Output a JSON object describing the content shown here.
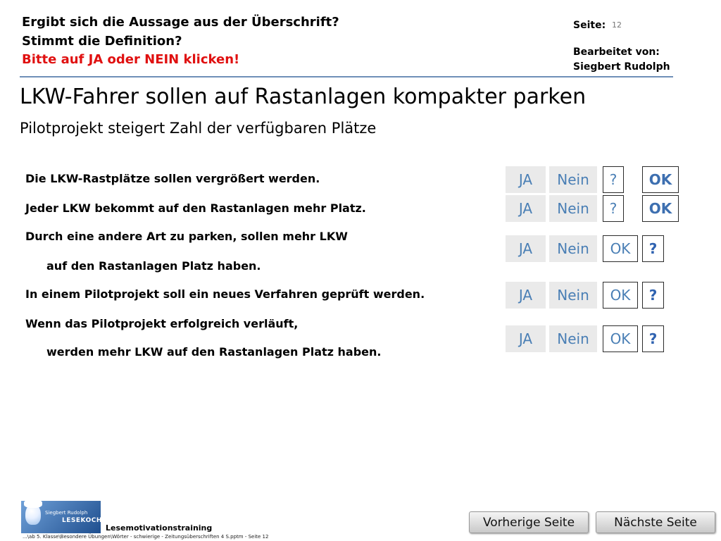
{
  "header": {
    "line1": "Ergibt sich die Aussage aus der Überschrift?",
    "line2": "Stimmt die Definition?",
    "line3": "Bitte auf JA oder NEIN klicken!",
    "page_label": "Seite:",
    "page_number": "12",
    "edited_label": "Bearbeitet von:",
    "editor": "Siegbert Rudolph"
  },
  "headline": "LKW-Fahrer sollen auf Rastanlagen kompakter parken",
  "subheadline": "Pilotprojekt steigert Zahl der verfügbaren Plätze",
  "statements": [
    "Die LKW-Rastplätze sollen vergrößert werden.",
    "Jeder LKW bekommt auf den Rastanlagen mehr Platz.",
    "Durch eine andere Art zu parken, sollen mehr LKW",
    "auf den Rastanlagen Platz haben.",
    "In einem Pilotprojekt soll ein neues Verfahren geprüft werden.",
    "Wenn das Pilotprojekt erfolgreich verläuft,",
    "werden mehr LKW auf den Rastanlagen Platz haben."
  ],
  "answer_rows": [
    {
      "ja": "JA",
      "nein": "Nein",
      "btn3": "?",
      "btn4": "OK"
    },
    {
      "ja": "JA",
      "nein": "Nein",
      "btn3": "?",
      "btn4": "OK"
    },
    {
      "ja": "JA",
      "nein": "Nein",
      "btn3": "OK",
      "btn4": "?"
    },
    {
      "ja": "JA",
      "nein": "Nein",
      "btn3": "OK",
      "btn4": "?"
    },
    {
      "ja": "JA",
      "nein": "Nein",
      "btn3": "OK",
      "btn4": "?"
    }
  ],
  "footer": {
    "logo_line1": "Siegbert Rudolph",
    "logo_line2": "LESEKOCH",
    "app_name": "Lesemotivationstraining",
    "file_path": "...\\ab 5. Klasse\\Besondere Übungen\\Wörter - schwierige - Zeitungsüberschriften 4 S.pptm - Seite 12",
    "prev_label": "Vorherige Seite",
    "next_label": "Nächste Seite"
  }
}
